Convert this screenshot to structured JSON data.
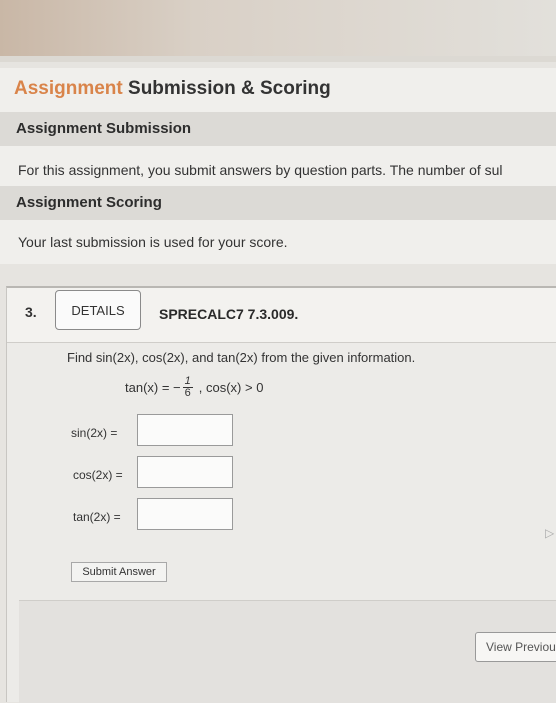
{
  "header": {
    "section_title_accent": "Assignment",
    "section_title_rest": " Submission & Scoring"
  },
  "submission": {
    "heading": "Assignment Submission",
    "text": "For this assignment, you submit answers by question parts. The number of sul"
  },
  "scoring": {
    "heading": "Assignment Scoring",
    "text": "Your last submission is used for your score."
  },
  "question": {
    "number": "3.",
    "details_label": "DETAILS",
    "code": "SPRECALC7 7.3.009.",
    "prompt": "Find sin(2x), cos(2x), and tan(2x) from the given information.",
    "given_left": "tan(x) = −",
    "given_num": "1",
    "given_den": "6",
    "given_right": ",   cos(x) > 0",
    "answers": [
      {
        "label": "sin(2x) =",
        "value": ""
      },
      {
        "label": "cos(2x) =",
        "value": ""
      },
      {
        "label": "tan(2x) =",
        "value": ""
      }
    ],
    "submit_label": "Submit Answer",
    "view_previous_label": "View Previou"
  }
}
